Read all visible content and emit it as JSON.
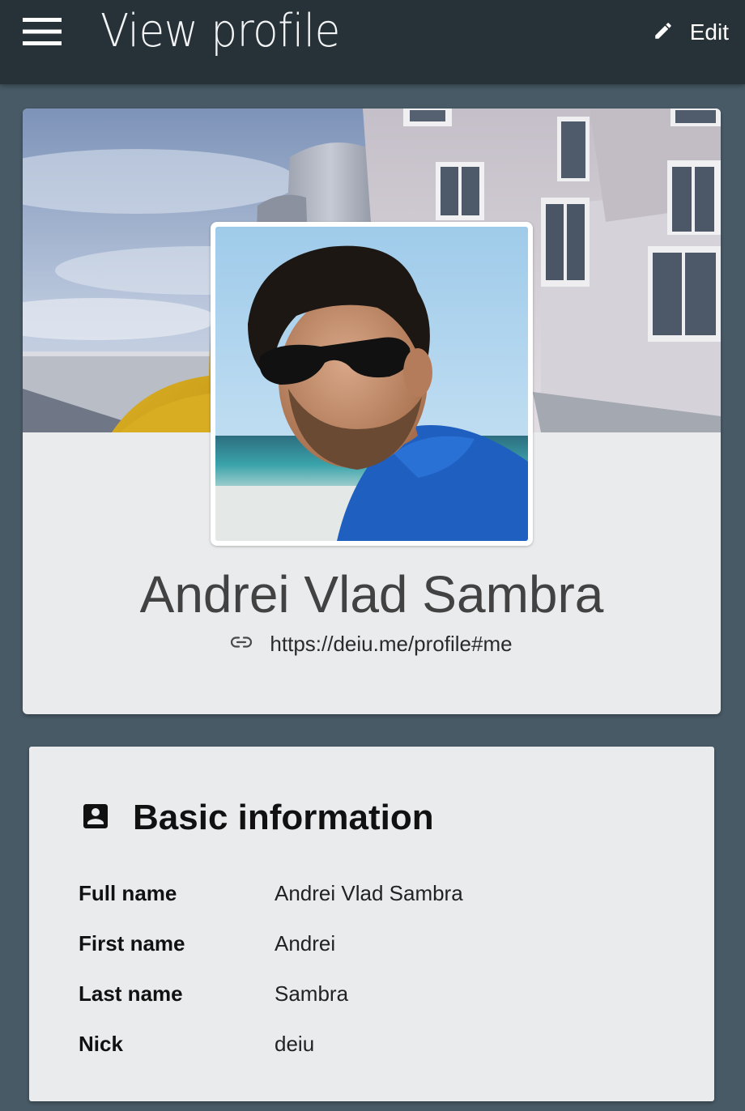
{
  "header": {
    "title": "View profile",
    "menu_icon": "hamburger-menu-icon",
    "edit_icon": "pencil-icon",
    "edit_label": "Edit"
  },
  "profile": {
    "name": "Andrei Vlad Sambra",
    "link_icon": "link-icon",
    "url": "https://deiu.me/profile#me"
  },
  "basic_info": {
    "icon": "contact-card-icon",
    "title": "Basic information",
    "rows": [
      {
        "label": "Full name",
        "value": "Andrei Vlad Sambra"
      },
      {
        "label": "First name",
        "value": "Andrei"
      },
      {
        "label": "Last name",
        "value": "Sambra"
      },
      {
        "label": "Nick",
        "value": "deiu"
      }
    ]
  },
  "colors": {
    "topbar": "#263238",
    "background": "#485a66",
    "card": "#eaebed"
  }
}
